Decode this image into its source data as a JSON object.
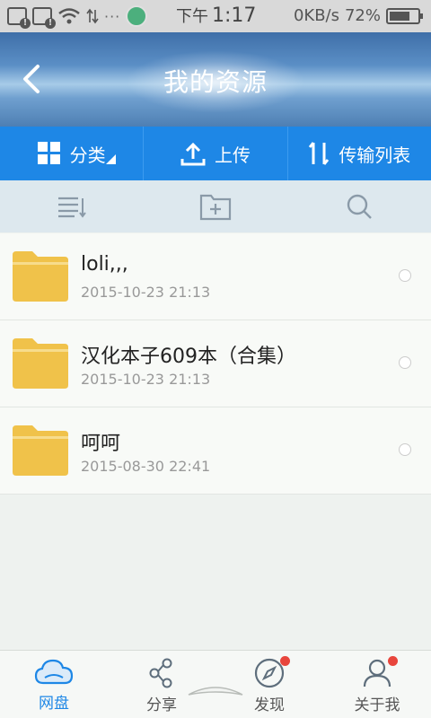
{
  "status_bar": {
    "time_prefix": "下午",
    "time": "1:17",
    "network_speed": "0KB/s",
    "battery": "72%",
    "battery_level": 0.72,
    "dots": "···"
  },
  "header": {
    "title": "我的资源",
    "back_icon": "chevron-left-icon"
  },
  "toolbar": {
    "category_label": "分类",
    "upload_label": "上传",
    "transfer_label": "传输列表"
  },
  "actions": {
    "icons": [
      "sort-list-icon",
      "new-folder-icon",
      "search-icon"
    ]
  },
  "files": [
    {
      "name": "loli,,,",
      "date": "2015-10-23  21:13"
    },
    {
      "name": "汉化本子609本（合集）",
      "date": "2015-10-23  21:13"
    },
    {
      "name": "呵呵",
      "date": "2015-08-30  22:41"
    }
  ],
  "bottom_nav": {
    "items": [
      {
        "label": "网盘",
        "icon": "cloud-icon",
        "active": true
      },
      {
        "label": "分享",
        "icon": "share-icon"
      },
      {
        "label": "发现",
        "icon": "compass-icon",
        "badge": true
      },
      {
        "label": "关于我",
        "icon": "person-icon",
        "badge": true
      }
    ]
  },
  "colors": {
    "accent": "#1e87e6",
    "folder": "#f0c24a",
    "badge": "#e8453c"
  }
}
